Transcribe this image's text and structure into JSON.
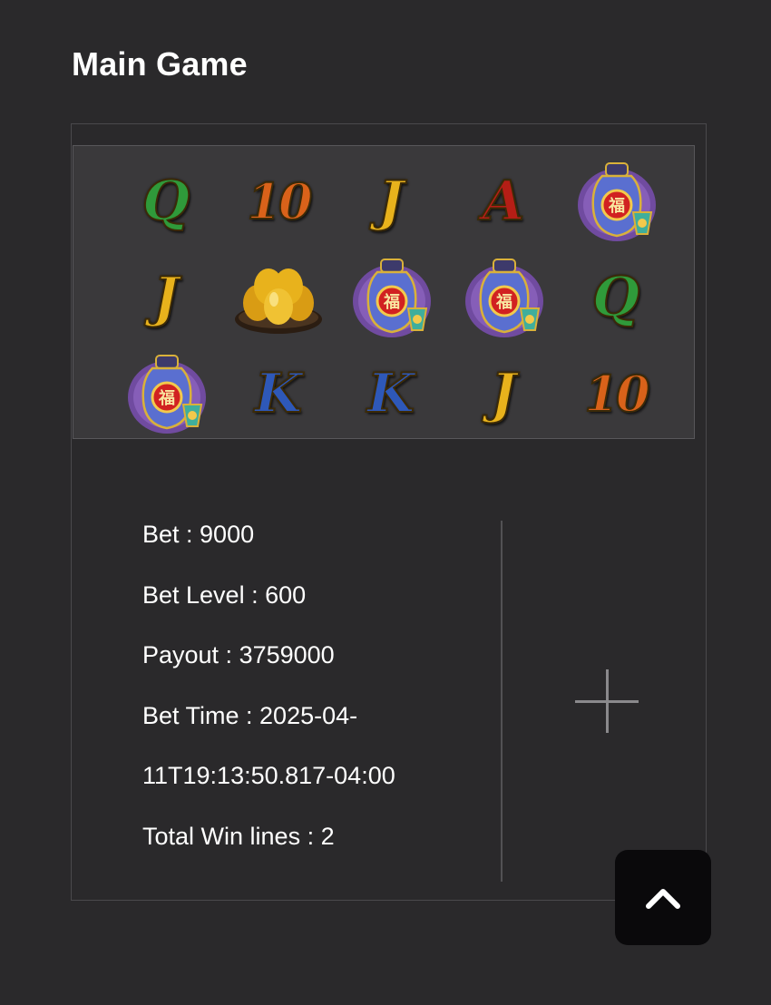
{
  "section": {
    "title": "Main Game"
  },
  "reels": {
    "rows": [
      [
        {
          "symbol": "Q",
          "color": "#2f9a3a"
        },
        {
          "symbol": "10",
          "color": "#d9621a"
        },
        {
          "symbol": "J",
          "color": "#e8b21c"
        },
        {
          "symbol": "A",
          "color": "#b51e16"
        },
        {
          "symbol": "vase-icon"
        }
      ],
      [
        {
          "symbol": "J",
          "color": "#e8b21c"
        },
        {
          "symbol": "golden-eggs-icon"
        },
        {
          "symbol": "vase-icon"
        },
        {
          "symbol": "vase-icon"
        },
        {
          "symbol": "Q",
          "color": "#2f9a3a"
        }
      ],
      [
        {
          "symbol": "vase-icon"
        },
        {
          "symbol": "K",
          "color": "#2e58b8"
        },
        {
          "symbol": "K",
          "color": "#2e58b8"
        },
        {
          "symbol": "J",
          "color": "#e8b21c"
        },
        {
          "symbol": "10",
          "color": "#d9621a"
        }
      ]
    ]
  },
  "info": {
    "bet": "Bet : 9000",
    "bet_level": "Bet Level : 600",
    "payout": "Payout : 3759000",
    "bet_time_line1": "Bet Time : 2025-04-",
    "bet_time_line2": "11T19:13:50.817-04:00",
    "total_win_lines": "Total Win lines : 2"
  },
  "controls": {
    "expand_icon": "plus-icon",
    "scroll_top_icon": "chevron-up-icon"
  }
}
